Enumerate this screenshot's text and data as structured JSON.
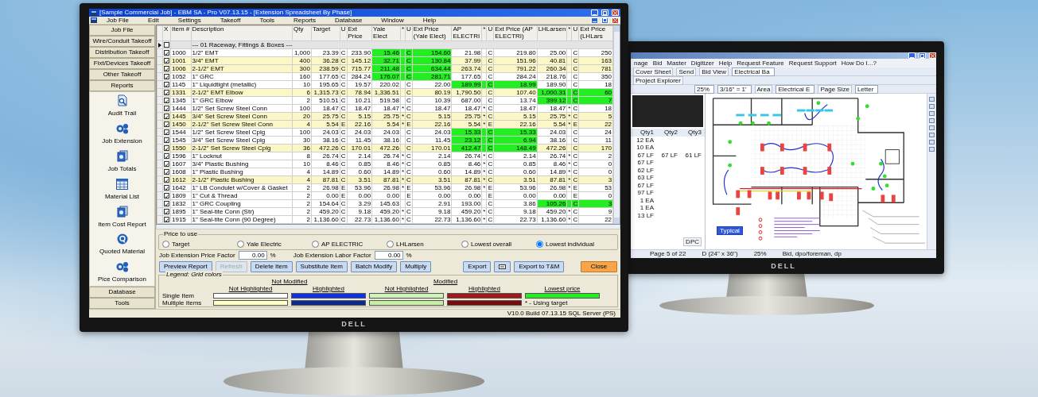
{
  "left_monitor": {
    "logo": "DELL",
    "window": {
      "title": "[Sample Commercial Job] - EBM SA - Pro V07.13.15 - [Extension Spreadsheet By Phase]",
      "menu": [
        "Job File",
        "Edit",
        "Settings",
        "Takeoff",
        "Tools",
        "Reports",
        "Database",
        "Window",
        "Help"
      ],
      "sidebar": {
        "nav": [
          "Job File",
          "Wire/Conduit Takeoff",
          "Distribution Takeoff",
          "Fixt/Devices Takeoff",
          "Other Takeoff",
          "Reports"
        ],
        "tools": [
          {
            "label": "Audit Trail",
            "kind": "audit"
          },
          {
            "label": "Job Extension",
            "kind": "coins"
          },
          {
            "label": "Job Totals",
            "kind": "stack"
          },
          {
            "label": "Material List",
            "kind": "sheet"
          },
          {
            "label": "Item Cost Report",
            "kind": "stack"
          },
          {
            "label": "Quoted Material",
            "kind": "coin"
          },
          {
            "label": "Pice Comparison",
            "kind": "coins"
          }
        ],
        "bottom": [
          "Database",
          "Tools"
        ]
      },
      "table": {
        "columns": [
          "X",
          "Item #",
          "Description",
          "Qty",
          "Target",
          "U",
          "Ext Price",
          "Yale Elect",
          "*",
          "U",
          "Ext Price (Yale Elect)",
          "AP ELECTRI",
          "*",
          "U",
          "Ext Price (AP ELECTRI)",
          "LHLarsen",
          "*",
          "U",
          "Ext Price (LHLars"
        ],
        "group_row": {
          "current": true,
          "checked": false,
          "label": "--- 01 Raceway, Fittings & Boxes ---"
        },
        "rows": [
          {
            "checked": true,
            "highlighted": false,
            "item": "1000",
            "description": "1/2\" EMT",
            "qty": "1,000",
            "target": "23.39",
            "unit": "C",
            "ext_price": "233.90",
            "vendors": [
              {
                "price": "15.46",
                "unit": "C",
                "ext_price": "154.60",
                "lowest": true
              },
              {
                "price": "21.98",
                "unit": "C",
                "ext_price": "219.80",
                "lowest": false
              },
              {
                "price": "25.00",
                "unit": "C",
                "ext_price": "250",
                "lowest": false
              }
            ]
          },
          {
            "checked": true,
            "highlighted": true,
            "item": "1001",
            "description": "3/4\" EMT",
            "qty": "400",
            "target": "36.28",
            "unit": "C",
            "ext_price": "145.12",
            "vendors": [
              {
                "price": "32.71",
                "unit": "C",
                "ext_price": "130.84",
                "lowest": true
              },
              {
                "price": "37.99",
                "unit": "C",
                "ext_price": "151.96",
                "lowest": false
              },
              {
                "price": "40.81",
                "unit": "C",
                "ext_price": "163",
                "lowest": false
              }
            ]
          },
          {
            "checked": true,
            "highlighted": true,
            "item": "1006",
            "description": "2-1/2\" EMT",
            "qty": "300",
            "target": "238.59",
            "unit": "C",
            "ext_price": "715.77",
            "vendors": [
              {
                "price": "211.48",
                "unit": "C",
                "ext_price": "634.44",
                "lowest": true
              },
              {
                "price": "263.74",
                "unit": "C",
                "ext_price": "791.22",
                "lowest": false
              },
              {
                "price": "260.34",
                "unit": "C",
                "ext_price": "781",
                "lowest": false
              }
            ]
          },
          {
            "checked": true,
            "highlighted": false,
            "item": "1052",
            "description": "1\" GRC",
            "qty": "160",
            "target": "177.65",
            "unit": "C",
            "ext_price": "284.24",
            "vendors": [
              {
                "price": "176.07",
                "unit": "C",
                "ext_price": "281.71",
                "lowest": true
              },
              {
                "price": "177.65",
                "unit": "C",
                "ext_price": "284.24",
                "lowest": false
              },
              {
                "price": "218.76",
                "unit": "C",
                "ext_price": "350",
                "lowest": false
              }
            ]
          },
          {
            "checked": true,
            "highlighted": false,
            "item": "1145",
            "description": "1\" Liquidtight (metallic)",
            "qty": "10",
            "target": "195.65",
            "unit": "C",
            "ext_price": "19.57",
            "vendors": [
              {
                "price": "220.02",
                "unit": "C",
                "ext_price": "22.00",
                "lowest": false
              },
              {
                "price": "189.99",
                "unit": "C",
                "ext_price": "18.99",
                "lowest": true
              },
              {
                "price": "189.90",
                "unit": "C",
                "ext_price": "18",
                "lowest": false
              }
            ]
          },
          {
            "checked": true,
            "highlighted": true,
            "item": "1331",
            "description": "2-1/2\" EMT Elbow",
            "qty": "6",
            "target": "1,315.73",
            "unit": "C",
            "ext_price": "78.94",
            "vendors": [
              {
                "price": "1,336.51",
                "unit": "C",
                "ext_price": "80.19",
                "lowest": false
              },
              {
                "price": "1,790.50",
                "unit": "C",
                "ext_price": "107.40",
                "lowest": false
              },
              {
                "price": "1,000.31",
                "unit": "C",
                "ext_price": "60",
                "lowest": true
              }
            ]
          },
          {
            "checked": true,
            "highlighted": false,
            "item": "1345",
            "description": "1\" GRC Elbow",
            "qty": "2",
            "target": "510.51",
            "unit": "C",
            "ext_price": "10.21",
            "vendors": [
              {
                "price": "519.58",
                "unit": "C",
                "ext_price": "10.39",
                "lowest": false
              },
              {
                "price": "687.00",
                "unit": "C",
                "ext_price": "13.74",
                "lowest": false
              },
              {
                "price": "399.12",
                "unit": "C",
                "ext_price": "7",
                "lowest": true
              }
            ]
          },
          {
            "checked": true,
            "highlighted": false,
            "item": "1444",
            "description": "1/2\" Set Screw Steel Conn",
            "qty": "100",
            "target": "18.47",
            "unit": "C",
            "ext_price": "18.47",
            "vendors": [
              {
                "price": "18.47",
                "mark": "*",
                "unit": "C",
                "ext_price": "18.47",
                "lowest": false
              },
              {
                "price": "18.47",
                "mark": "*",
                "unit": "C",
                "ext_price": "18.47",
                "lowest": false
              },
              {
                "price": "18.47",
                "mark": "*",
                "unit": "C",
                "ext_price": "18",
                "lowest": false
              }
            ]
          },
          {
            "checked": true,
            "highlighted": true,
            "item": "1445",
            "description": "3/4\" Set Screw Steel Conn",
            "qty": "20",
            "target": "25.75",
            "unit": "C",
            "ext_price": "5.15",
            "vendors": [
              {
                "price": "25.75",
                "mark": "*",
                "unit": "C",
                "ext_price": "5.15",
                "lowest": false
              },
              {
                "price": "25.75",
                "mark": "*",
                "unit": "C",
                "ext_price": "5.15",
                "lowest": false
              },
              {
                "price": "25.75",
                "mark": "*",
                "unit": "C",
                "ext_price": "5",
                "lowest": false
              }
            ]
          },
          {
            "checked": true,
            "highlighted": true,
            "item": "1450",
            "description": "2-1/2\" Set Screw Steel Conn",
            "qty": "4",
            "target": "5.54",
            "unit": "E",
            "ext_price": "22.16",
            "vendors": [
              {
                "price": "5.54",
                "mark": "*",
                "unit": "E",
                "ext_price": "22.16",
                "lowest": false
              },
              {
                "price": "5.54",
                "mark": "*",
                "unit": "E",
                "ext_price": "22.16",
                "lowest": false
              },
              {
                "price": "5.54",
                "mark": "*",
                "unit": "E",
                "ext_price": "22",
                "lowest": false
              }
            ]
          },
          {
            "checked": true,
            "highlighted": false,
            "item": "1544",
            "description": "1/2\" Set Screw Steel Cplg",
            "qty": "100",
            "target": "24.03",
            "unit": "C",
            "ext_price": "24.03",
            "vendors": [
              {
                "price": "24.03",
                "unit": "C",
                "ext_price": "24.03",
                "lowest": false
              },
              {
                "price": "15.33",
                "unit": "C",
                "ext_price": "15.33",
                "lowest": true
              },
              {
                "price": "24.03",
                "unit": "C",
                "ext_price": "24",
                "lowest": false
              }
            ]
          },
          {
            "checked": true,
            "highlighted": false,
            "item": "1545",
            "description": "3/4\" Set Screw Steel Cplg",
            "qty": "30",
            "target": "38.16",
            "unit": "C",
            "ext_price": "11.45",
            "vendors": [
              {
                "price": "38.16",
                "unit": "C",
                "ext_price": "11.45",
                "lowest": false
              },
              {
                "price": "23.12",
                "unit": "C",
                "ext_price": "6.94",
                "lowest": true
              },
              {
                "price": "38.16",
                "unit": "C",
                "ext_price": "11",
                "lowest": false
              }
            ]
          },
          {
            "checked": true,
            "highlighted": true,
            "item": "1550",
            "description": "2-1/2\" Set Screw Steel Cplg",
            "qty": "36",
            "target": "472.26",
            "unit": "C",
            "ext_price": "170.01",
            "vendors": [
              {
                "price": "472.26",
                "unit": "C",
                "ext_price": "170.01",
                "lowest": false
              },
              {
                "price": "412.47",
                "unit": "C",
                "ext_price": "148.49",
                "lowest": true
              },
              {
                "price": "472.26",
                "unit": "C",
                "ext_price": "170",
                "lowest": false
              }
            ]
          },
          {
            "checked": true,
            "highlighted": false,
            "item": "1596",
            "description": "1\" Locknut",
            "qty": "8",
            "target": "26.74",
            "unit": "C",
            "ext_price": "2.14",
            "vendors": [
              {
                "price": "26.74",
                "mark": "*",
                "unit": "C",
                "ext_price": "2.14",
                "lowest": false
              },
              {
                "price": "26.74",
                "mark": "*",
                "unit": "C",
                "ext_price": "2.14",
                "lowest": false
              },
              {
                "price": "26.74",
                "mark": "*",
                "unit": "C",
                "ext_price": "2",
                "lowest": false
              }
            ]
          },
          {
            "checked": true,
            "highlighted": false,
            "item": "1607",
            "description": "3/4\" Plastic Bushing",
            "qty": "10",
            "target": "8.46",
            "unit": "C",
            "ext_price": "0.85",
            "vendors": [
              {
                "price": "8.46",
                "mark": "*",
                "unit": "C",
                "ext_price": "0.85",
                "lowest": false
              },
              {
                "price": "8.46",
                "mark": "*",
                "unit": "C",
                "ext_price": "0.85",
                "lowest": false
              },
              {
                "price": "8.46",
                "mark": "*",
                "unit": "C",
                "ext_price": "0",
                "lowest": false
              }
            ]
          },
          {
            "checked": true,
            "highlighted": false,
            "item": "1608",
            "description": "1\" Plastic Bushing",
            "qty": "4",
            "target": "14.89",
            "unit": "C",
            "ext_price": "0.60",
            "vendors": [
              {
                "price": "14.89",
                "mark": "*",
                "unit": "C",
                "ext_price": "0.60",
                "lowest": false
              },
              {
                "price": "14.89",
                "mark": "*",
                "unit": "C",
                "ext_price": "0.60",
                "lowest": false
              },
              {
                "price": "14.89",
                "mark": "*",
                "unit": "C",
                "ext_price": "0",
                "lowest": false
              }
            ]
          },
          {
            "checked": true,
            "highlighted": true,
            "item": "1612",
            "description": "2-1/2\" Plastic Bushing",
            "qty": "4",
            "target": "87.81",
            "unit": "C",
            "ext_price": "3.51",
            "vendors": [
              {
                "price": "87.81",
                "mark": "*",
                "unit": "C",
                "ext_price": "3.51",
                "lowest": false
              },
              {
                "price": "87.81",
                "mark": "*",
                "unit": "C",
                "ext_price": "3.51",
                "lowest": false
              },
              {
                "price": "87.81",
                "mark": "*",
                "unit": "C",
                "ext_price": "3",
                "lowest": false
              }
            ]
          },
          {
            "checked": true,
            "highlighted": false,
            "item": "1642",
            "description": "1\" LB Condulet w/Cover & Gasket",
            "qty": "2",
            "target": "26.98",
            "unit": "E",
            "ext_price": "53.96",
            "vendors": [
              {
                "price": "26.98",
                "mark": "*",
                "unit": "E",
                "ext_price": "53.96",
                "lowest": false
              },
              {
                "price": "26.98",
                "mark": "*",
                "unit": "E",
                "ext_price": "53.96",
                "lowest": false
              },
              {
                "price": "26.98",
                "mark": "*",
                "unit": "E",
                "ext_price": "53",
                "lowest": false
              }
            ]
          },
          {
            "checked": true,
            "highlighted": false,
            "item": "1809",
            "description": "1\" Cut & Thread",
            "qty": "2",
            "target": "0.00",
            "unit": "E",
            "ext_price": "0.00",
            "vendors": [
              {
                "price": "0.00",
                "unit": "E",
                "ext_price": "0.00",
                "lowest": false
              },
              {
                "price": "0.00",
                "unit": "E",
                "ext_price": "0.00",
                "lowest": false
              },
              {
                "price": "0.00",
                "unit": "E",
                "ext_price": "0",
                "lowest": false
              }
            ]
          },
          {
            "checked": true,
            "highlighted": false,
            "item": "1832",
            "description": "1\" GRC Coupling",
            "qty": "2",
            "target": "154.64",
            "unit": "C",
            "ext_price": "3.29",
            "vendors": [
              {
                "price": "145.63",
                "unit": "C",
                "ext_price": "2.91",
                "lowest": false
              },
              {
                "price": "193.00",
                "unit": "C",
                "ext_price": "3.86",
                "lowest": false
              },
              {
                "price": "105.26",
                "unit": "C",
                "ext_price": "3",
                "lowest": true
              }
            ]
          },
          {
            "checked": true,
            "highlighted": false,
            "item": "1895",
            "description": "1\" Seal-tite Conn (Str)",
            "qty": "2",
            "target": "459.20",
            "unit": "C",
            "ext_price": "9.18",
            "vendors": [
              {
                "price": "459.20",
                "mark": "*",
                "unit": "C",
                "ext_price": "9.18",
                "lowest": false
              },
              {
                "price": "459.20",
                "mark": "*",
                "unit": "C",
                "ext_price": "9.18",
                "lowest": false
              },
              {
                "price": "459.20",
                "mark": "*",
                "unit": "C",
                "ext_price": "9",
                "lowest": false
              }
            ]
          },
          {
            "checked": true,
            "highlighted": false,
            "item": "1915",
            "description": "1\" Seal-tite Conn (90 Degree)",
            "qty": "2",
            "target": "1,136.60",
            "unit": "C",
            "ext_price": "22.73",
            "vendors": [
              {
                "price": "1,136.60",
                "mark": "*",
                "unit": "C",
                "ext_price": "22.73",
                "lowest": false
              },
              {
                "price": "1,136.60",
                "mark": "*",
                "unit": "C",
                "ext_price": "22.73",
                "lowest": false
              },
              {
                "price": "1,136.60",
                "mark": "*",
                "unit": "C",
                "ext_price": "22",
                "lowest": false
              }
            ]
          }
        ]
      },
      "price_to_use": {
        "label": "Price to use",
        "options": [
          {
            "label": "Target",
            "selected": false
          },
          {
            "label": "Yale Electric",
            "selected": false
          },
          {
            "label": "AP ELECTRIC",
            "selected": false
          },
          {
            "label": "LHLarsen",
            "selected": false
          },
          {
            "label": "Lowest overall",
            "selected": false
          },
          {
            "label": "Lowest individual",
            "selected": true
          }
        ]
      },
      "factors": [
        {
          "label": "Job Extension Price Factor",
          "value": "0.00",
          "unit": "%"
        },
        {
          "label": "Job Extension Labor Factor",
          "value": "0.00",
          "unit": "%"
        }
      ],
      "button_groups": [
        {
          "buttons": [
            {
              "label": "Preview Report",
              "kind": "normal",
              "disabled": false
            },
            {
              "label": "Refresh",
              "kind": "normal",
              "disabled": true
            },
            {
              "label": "Delete Item",
              "kind": "normal",
              "disabled": false
            },
            {
              "label": "Substitute Item",
              "kind": "normal",
              "disabled": false
            },
            {
              "label": "Batch Modify",
              "kind": "normal",
              "disabled": false
            },
            {
              "label": "Multiply",
              "kind": "normal",
              "disabled": false
            }
          ]
        },
        {
          "buttons": [
            {
              "label": "Export",
              "kind": "normal",
              "disabled": false
            },
            {
              "kind": "icon",
              "disabled": false
            },
            {
              "label": "Export to T&M",
              "kind": "normal",
              "disabled": false
            }
          ]
        },
        {
          "buttons": [
            {
              "label": "Close",
              "kind": "close",
              "disabled": false
            }
          ]
        }
      ],
      "legend": {
        "title": "Legend: Grid colors",
        "row_labels": [
          "Single Item",
          "Multiple Items"
        ],
        "groups": [
          {
            "label": "Not Modified",
            "columns": [
              {
                "label": "Not Highlighted",
                "swatches": [
                  {
                    "color": "#ffffff"
                  },
                  {
                    "color": "#ffffc8"
                  }
                ]
              },
              {
                "label": "Highlighted",
                "swatches": [
                  {
                    "color": "#1030e8"
                  },
                  {
                    "color": "#0c2a8c"
                  }
                ]
              }
            ]
          },
          {
            "label": "Modified",
            "columns": [
              {
                "label": "Not Highlighted",
                "swatches": [
                  {
                    "color": "#cdf3b8"
                  },
                  {
                    "color": "#c6eea6"
                  }
                ]
              },
              {
                "label": "Highlighted",
                "swatches": [
                  {
                    "color": "#a01818"
                  },
                  {
                    "color": "#780c0c"
                  }
                ]
              }
            ]
          }
        ],
        "lowest": {
          "label": "Lowest price",
          "color": "#22ee22"
        },
        "note": "* - Using target"
      },
      "status": "V10.0 Build 07.13.15 SQL Server (PS)"
    }
  },
  "right_monitor": {
    "logo": "DELL",
    "window": {
      "menu": [
        "nage",
        "Bid",
        "Master",
        "Digitizer",
        "Help",
        "Request Feature",
        "Request Support",
        "How Do I...?"
      ],
      "toolbar": [
        {
          "label": "Cover Sheet",
          "kind": "button"
        },
        {
          "label": "Send",
          "kind": "button"
        },
        {
          "label": "Bid View",
          "kind": "button"
        },
        {
          "label": "Electrical Ba",
          "kind": "dropdown"
        }
      ],
      "panel_tab": "Project Explorer",
      "view_bar": [
        {
          "label": "25%",
          "kind": "dropdown"
        },
        {
          "label": "3/16\" = 1'",
          "kind": "dropdown"
        },
        {
          "label": "Area",
          "kind": "button"
        },
        {
          "label": "Electrical E",
          "kind": "dropdown"
        },
        {
          "label": "Page Size",
          "kind": "button"
        },
        {
          "label": "Letter",
          "kind": "dropdown"
        }
      ],
      "list_headers": [
        "Qty1",
        "Qty2",
        "Qty3"
      ],
      "quantities": [
        [
          "12 EA"
        ],
        [
          "10 EA"
        ],
        [
          "67 LF",
          "67 LF",
          "61 LF"
        ],
        [
          "67 LF"
        ],
        [
          "62 LF"
        ],
        [
          "63 LF"
        ],
        [
          "67 LF"
        ],
        [
          "97 LF"
        ],
        [
          "1 EA"
        ],
        [
          "1 EA"
        ],
        [
          "13 LF"
        ]
      ],
      "panel_button": "DPC",
      "tag": "Typical",
      "status": [
        "Page 5 of 22",
        "D (24\" x 36\")",
        "25%",
        "Bid, dpo/foreman, dp"
      ]
    }
  }
}
